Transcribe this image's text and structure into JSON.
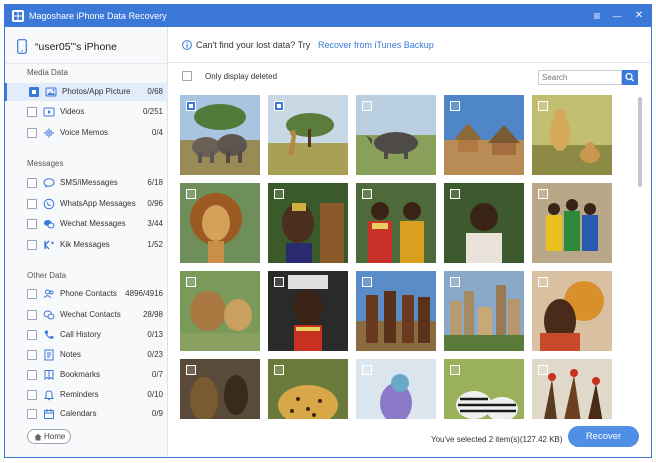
{
  "app": {
    "title": "Magoshare iPhone Data Recovery"
  },
  "window_controls": {
    "menu": "≡",
    "minimize": "—",
    "close": "✕"
  },
  "device": {
    "name": "“user05”'s iPhone"
  },
  "sections": [
    {
      "title": "Media Data",
      "items": [
        {
          "label": "Photos/App Picture",
          "count": "0/68",
          "icon": "photo-icon",
          "checked": true,
          "active": true
        },
        {
          "label": "Videos",
          "count": "0/251",
          "icon": "video-icon",
          "checked": false,
          "active": false
        },
        {
          "label": "Voice Memos",
          "count": "0/4",
          "icon": "voice-memo-icon",
          "checked": false,
          "active": false
        }
      ]
    },
    {
      "title": "Messages",
      "items": [
        {
          "label": "SMS/iMessages",
          "count": "6/18",
          "icon": "message-bubble-icon",
          "checked": false
        },
        {
          "label": "WhatsApp Messages",
          "count": "0/96",
          "icon": "whatsapp-icon",
          "checked": false
        },
        {
          "label": "Wechat Messages",
          "count": "3/44",
          "icon": "wechat-icon",
          "checked": false
        },
        {
          "label": "Kik Messages",
          "count": "1/52",
          "icon": "kik-icon",
          "checked": false
        }
      ]
    },
    {
      "title": "Other Data",
      "items": [
        {
          "label": "Phone Contacts",
          "count": "4896/4916",
          "icon": "contacts-icon",
          "checked": false
        },
        {
          "label": "Wechat Contacts",
          "count": "28/98",
          "icon": "wechat-contacts-icon",
          "checked": false
        },
        {
          "label": "Call History",
          "count": "0/13",
          "icon": "phone-icon",
          "checked": false
        },
        {
          "label": "Notes",
          "count": "0/23",
          "icon": "notes-icon",
          "checked": false
        },
        {
          "label": "Bookmarks",
          "count": "0/7",
          "icon": "bookmark-icon",
          "checked": false
        },
        {
          "label": "Reminders",
          "count": "0/10",
          "icon": "bell-icon",
          "checked": false
        },
        {
          "label": "Calendars",
          "count": "0/9",
          "icon": "calendar-icon",
          "checked": false
        }
      ]
    }
  ],
  "home_button": "Home",
  "topbar": {
    "hint": "Can't find your lost data? Try",
    "link": "Recover from iTunes Backup"
  },
  "filter": {
    "only_deleted_label": "Only display deleted",
    "only_deleted_checked": false
  },
  "search": {
    "placeholder": "Search",
    "value": ""
  },
  "photos": [
    {
      "subject": "elephants",
      "checked": true
    },
    {
      "subject": "giraffe-savanna",
      "checked": true
    },
    {
      "subject": "rhinoceros",
      "checked": false
    },
    {
      "subject": "village-huts",
      "checked": false
    },
    {
      "subject": "cheetahs",
      "checked": false
    },
    {
      "subject": "lion",
      "checked": false
    },
    {
      "subject": "tribal-portrait",
      "checked": false
    },
    {
      "subject": "tribal-women",
      "checked": false
    },
    {
      "subject": "child-portrait",
      "checked": false
    },
    {
      "subject": "women-in-dresses",
      "checked": false
    },
    {
      "subject": "lion-pride",
      "checked": false
    },
    {
      "subject": "painted-face",
      "checked": false
    },
    {
      "subject": "tribal-men",
      "checked": false
    },
    {
      "subject": "city-skyline",
      "checked": false
    },
    {
      "subject": "woman-with-gourd",
      "checked": false
    },
    {
      "subject": "masks-crafts",
      "checked": false
    },
    {
      "subject": "leopard",
      "checked": false
    },
    {
      "subject": "lilac-breasted-roller",
      "checked": false
    },
    {
      "subject": "zebras",
      "checked": false
    },
    {
      "subject": "dancers",
      "checked": false
    }
  ],
  "footer": {
    "status": "You've selected 2 item(s)(127.42 KB)",
    "recover_label": "Recover"
  },
  "colors": {
    "accent": "#3b78d8",
    "recover_button": "#4f8fe6",
    "active_item_bg": "#e2ecfa"
  }
}
